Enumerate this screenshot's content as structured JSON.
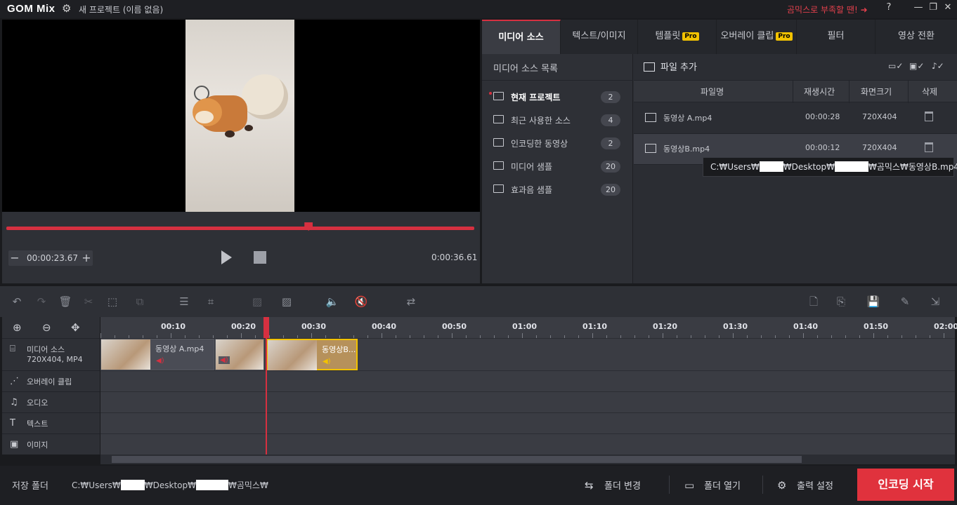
{
  "app": {
    "logo": "GOM Mix",
    "project_title": "새 프로젝트 (이름 없음)",
    "promo": "곰믹스로 부족할 땐! ➜",
    "help": "?",
    "minimize": "—",
    "restore": "❐",
    "close": "✕"
  },
  "player": {
    "time_minus": "−",
    "current_time": "00:00:23.67",
    "time_plus": "+",
    "total_time": "0:00:36.61",
    "progress": 0.646
  },
  "tabs": [
    {
      "label": "미디어 소스",
      "pro": false
    },
    {
      "label": "텍스트/이미지",
      "pro": false
    },
    {
      "label": "템플릿",
      "pro": true
    },
    {
      "label": "오버레이 클립",
      "pro": true
    },
    {
      "label": "필터",
      "pro": false
    },
    {
      "label": "영상 전환",
      "pro": false
    }
  ],
  "pro_badge": "Pro",
  "source_list": {
    "heading": "미디어 소스 목록",
    "items": [
      {
        "label": "현재 프로젝트",
        "count": "2"
      },
      {
        "label": "최근 사용한 소스",
        "count": "4"
      },
      {
        "label": "인코딩한 동영상",
        "count": "2"
      },
      {
        "label": "미디어 샘플",
        "count": "20"
      },
      {
        "label": "효과음 샘플",
        "count": "20"
      }
    ]
  },
  "file_panel": {
    "add_file": "파일 추가",
    "columns": {
      "name": "파일명",
      "duration": "재생시간",
      "resolution": "화면크기",
      "delete": "삭제"
    },
    "rows": [
      {
        "name": "동영상 A.mp4",
        "duration": "00:00:28",
        "resolution": "720X404"
      },
      {
        "name": "동영상B.mp4",
        "duration": "00:00:12",
        "resolution": "720X404"
      }
    ],
    "tooltip": {
      "p1": "C:₩Users₩",
      "p2": "₩Desktop₩",
      "p3": "₩곰믹스₩동영상B.mp4"
    }
  },
  "timeline": {
    "ruler": [
      "00:10",
      "00:20",
      "00:30",
      "00:40",
      "00:50",
      "01:00",
      "01:10",
      "01:20",
      "01:30",
      "01:40",
      "01:50",
      "02:00"
    ],
    "tracks": [
      {
        "icon": "film-icon",
        "label": "미디어 소스",
        "sub": "720X404, MP4"
      },
      {
        "icon": "overlay-icon",
        "label": "오버레이 클립"
      },
      {
        "icon": "music-icon",
        "label": "오디오"
      },
      {
        "icon": "text-icon",
        "label": "텍스트"
      },
      {
        "icon": "image-icon",
        "label": "이미지"
      }
    ],
    "clips": [
      {
        "name": "동영상 A.mp4"
      },
      {
        "name": ""
      },
      {
        "name": "동영상B..."
      }
    ]
  },
  "bottom": {
    "save_label": "저장 폴더",
    "path_p1": "C:₩Users₩",
    "path_p2": "₩Desktop₩",
    "path_p3": "₩곰믹스₩",
    "change_folder": "폴더 변경",
    "open_folder": "폴더 열기",
    "output_settings": "출력 설정",
    "start_encoding": "인코딩 시작"
  }
}
